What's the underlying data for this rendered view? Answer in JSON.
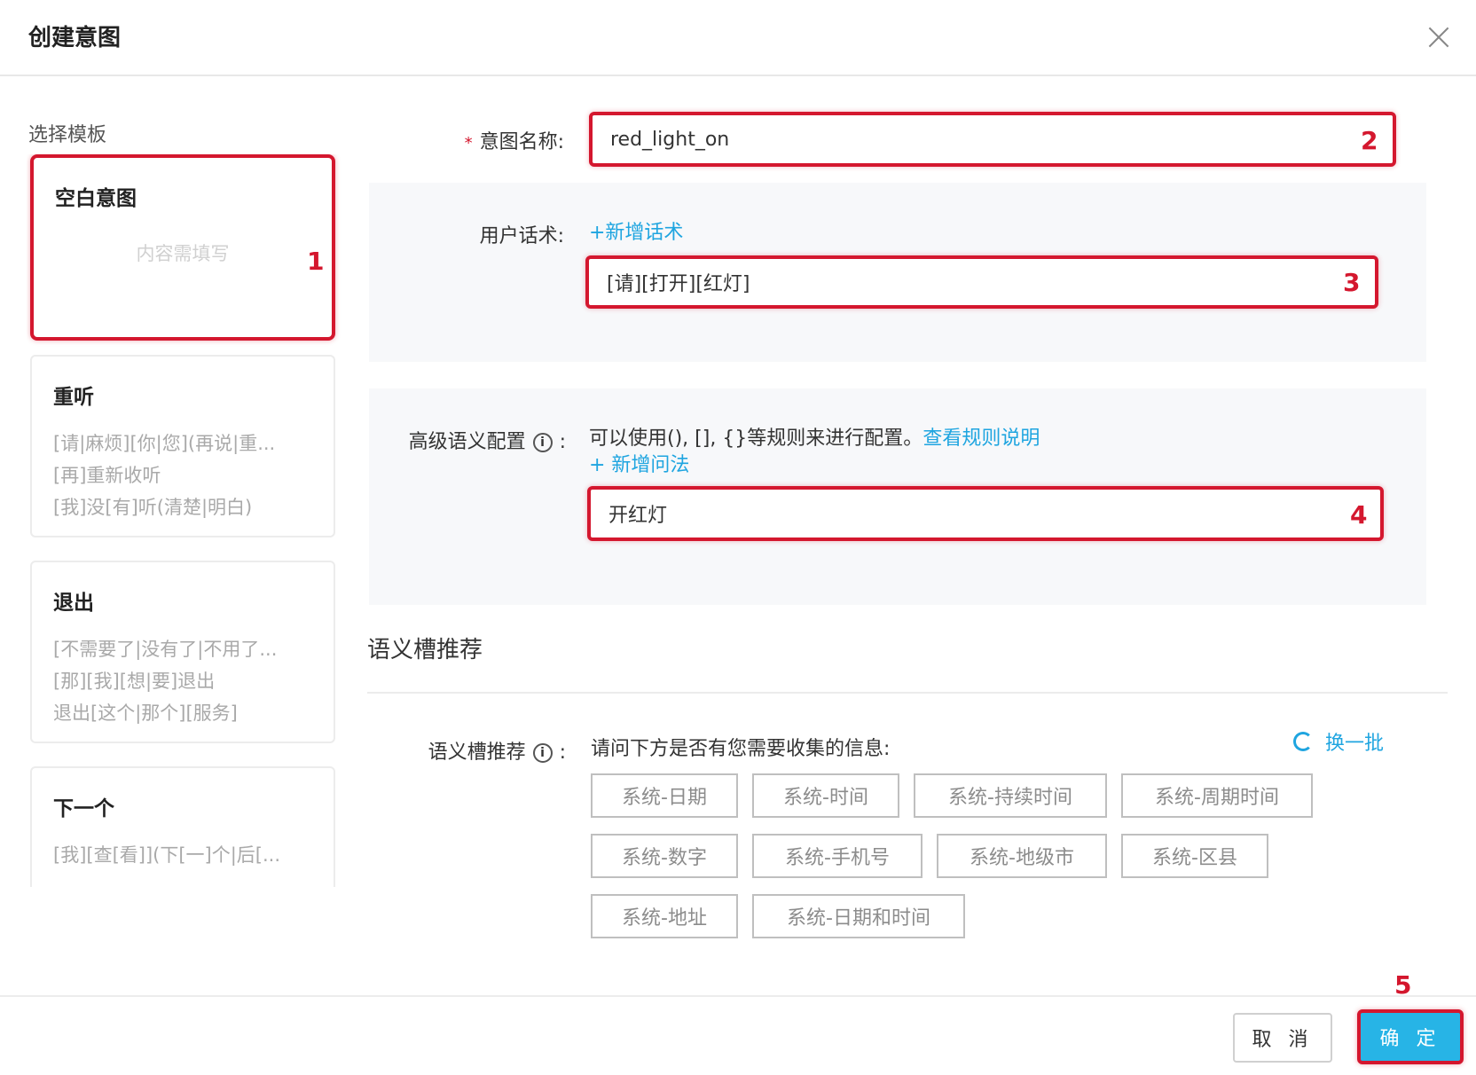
{
  "dialog": {
    "title": "创建意图"
  },
  "templates": {
    "heading": "选择模板",
    "items": [
      {
        "title": "空白意图",
        "placeholder": "内容需填写",
        "lines": []
      },
      {
        "title": "重听",
        "lines": [
          "[请|麻烦][你|您](再说|重...",
          "[再]重新收听",
          "[我]没[有]听(清楚|明白)"
        ]
      },
      {
        "title": "退出",
        "lines": [
          "[不需要了|没有了|不用了...",
          "[那][我][想|要]退出",
          "退出[这个|那个][服务]"
        ]
      },
      {
        "title": "下一个",
        "lines": [
          "[我][查[看]](下[一]个|后[..."
        ]
      }
    ]
  },
  "form": {
    "required_mark": "*",
    "intent_name": {
      "label": "意图名称:",
      "value": "red_light_on"
    },
    "utterance": {
      "label": "用户话术:",
      "add_link": "+新增话术",
      "value": "[请][打开][红灯]"
    },
    "advanced": {
      "label": "高级语义配置",
      "colon": ":",
      "info": "i",
      "hint": "可以使用(), [], {}等规则来进行配置。",
      "rule_link": "查看规则说明",
      "add_link": "+ 新增问法",
      "value": "开红灯"
    }
  },
  "slots": {
    "section_title": "语义槽推荐",
    "label": "语义槽推荐",
    "colon": ":",
    "info": "i",
    "question": "请问下方是否有您需要收集的信息:",
    "refresh": "换一批",
    "tags": [
      "系统-日期",
      "系统-时间",
      "系统-持续时间",
      "系统-周期时间",
      "系统-数字",
      "系统-手机号",
      "系统-地级市",
      "系统-区县",
      "系统-地址",
      "系统-日期和时间"
    ]
  },
  "footer": {
    "cancel": "取 消",
    "ok": "确 定"
  },
  "annotations": [
    "1",
    "2",
    "3",
    "4",
    "5"
  ],
  "colors": {
    "accent": "#1fa5e0",
    "highlight": "#d4172e",
    "primary_button": "#27b4e6"
  }
}
